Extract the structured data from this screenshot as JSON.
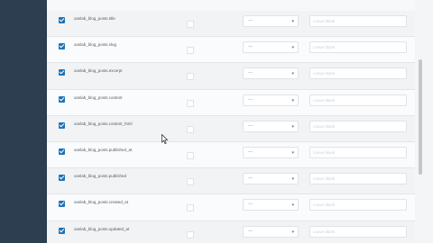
{
  "rows": [
    {
      "field": "xanlab_blog_posts.title",
      "checked": true,
      "type_value": "—",
      "value_placeholder": "Leave blank"
    },
    {
      "field": "xanlab_blog_posts.slug",
      "checked": true,
      "type_value": "—",
      "value_placeholder": "Leave blank"
    },
    {
      "field": "xanlab_blog_posts.excerpt",
      "checked": true,
      "type_value": "—",
      "value_placeholder": "Leave blank"
    },
    {
      "field": "xanlab_blog_posts.content",
      "checked": true,
      "type_value": "—",
      "value_placeholder": "Leave blank"
    },
    {
      "field": "xanlab_blog_posts.content_html",
      "checked": true,
      "type_value": "—",
      "value_placeholder": "Leave blank"
    },
    {
      "field": "xanlab_blog_posts.published_at",
      "checked": true,
      "type_value": "—",
      "value_placeholder": "Leave blank"
    },
    {
      "field": "xanlab_blog_posts.published",
      "checked": true,
      "type_value": "—",
      "value_placeholder": "Leave blank"
    },
    {
      "field": "xanlab_blog_posts.created_at",
      "checked": true,
      "type_value": "—",
      "value_placeholder": "Leave blank"
    },
    {
      "field": "xanlab_blog_posts.updated_at",
      "checked": true,
      "type_value": "—",
      "value_placeholder": "Leave blank"
    }
  ],
  "icons": {
    "dropdown": "chevron-down-icon",
    "check": "check-icon",
    "cursor": "mouse-pointer-icon"
  },
  "colors": {
    "sidebar": "#2c3e50",
    "checkbox": "#1f73b7"
  }
}
